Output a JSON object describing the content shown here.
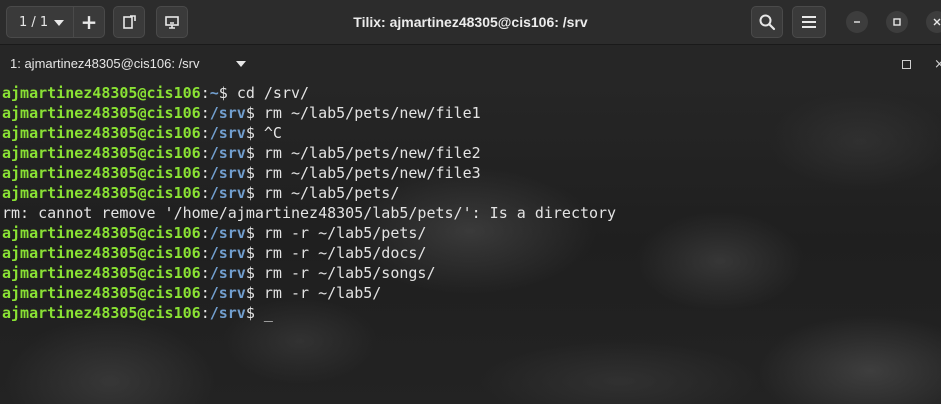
{
  "header": {
    "session_counter": "1 / 1",
    "window_title": "Tilix: ajmartinez48305@cis106: /srv"
  },
  "terminal_title": "1: ajmartinez48305@cis106: /srv",
  "prompt": {
    "user_host": "ajmartinez48305@cis106"
  },
  "lines": [
    {
      "type": "prompt",
      "path": "~",
      "command": "cd /srv/"
    },
    {
      "type": "prompt",
      "path": "/srv",
      "command": "rm ~/lab5/pets/new/file1"
    },
    {
      "type": "prompt",
      "path": "/srv",
      "command": "^C"
    },
    {
      "type": "prompt",
      "path": "/srv",
      "command": "rm ~/lab5/pets/new/file2"
    },
    {
      "type": "prompt",
      "path": "/srv",
      "command": "rm ~/lab5/pets/new/file3"
    },
    {
      "type": "prompt",
      "path": "/srv",
      "command": "rm ~/lab5/pets/"
    },
    {
      "type": "output",
      "text": "rm: cannot remove '/home/ajmartinez48305/lab5/pets/': Is a directory"
    },
    {
      "type": "prompt",
      "path": "/srv",
      "command": "rm -r ~/lab5/pets/"
    },
    {
      "type": "prompt",
      "path": "/srv",
      "command": "rm -r ~/lab5/docs/"
    },
    {
      "type": "prompt",
      "path": "/srv",
      "command": "rm -r ~/lab5/songs/"
    },
    {
      "type": "prompt",
      "path": "/srv",
      "command": "rm -r ~/lab5/"
    },
    {
      "type": "prompt",
      "path": "/srv",
      "command": ""
    }
  ],
  "colors": {
    "prompt_user": "#8ae234",
    "prompt_path": "#729fcf",
    "text": "#e3e3e3",
    "header_bg": "#2c2c2c"
  },
  "icons": {
    "sessions_caret": "chevron-down-icon",
    "add": "plus-icon",
    "detach": "detach-terminal-icon",
    "broadcast": "broadcast-input-icon",
    "search": "search-icon",
    "menu": "hamburger-menu-icon",
    "minimize": "minimize-icon",
    "maximize": "maximize-icon",
    "close": "close-icon"
  }
}
